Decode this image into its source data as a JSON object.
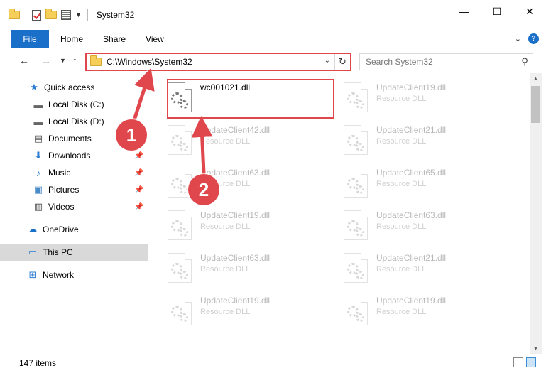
{
  "window": {
    "title": "System32",
    "controls": {
      "minimize": "—",
      "maximize": "☐",
      "close": "✕"
    }
  },
  "ribbon": {
    "tabs": [
      {
        "label": "File"
      },
      {
        "label": "Home"
      },
      {
        "label": "Share"
      },
      {
        "label": "View"
      }
    ]
  },
  "address": {
    "path": "C:\\Windows\\System32",
    "search_placeholder": "Search System32"
  },
  "sidebar": {
    "items": [
      {
        "label": "Quick access",
        "icon": "star-icon"
      },
      {
        "label": "Local Disk (C:)",
        "icon": "drive-icon"
      },
      {
        "label": "Local Disk (D:)",
        "icon": "drive-icon"
      },
      {
        "label": "Documents",
        "icon": "document-icon"
      },
      {
        "label": "Downloads",
        "icon": "download-icon"
      },
      {
        "label": "Music",
        "icon": "music-icon"
      },
      {
        "label": "Pictures",
        "icon": "pictures-icon"
      },
      {
        "label": "Videos",
        "icon": "videos-icon"
      },
      {
        "label": "OneDrive",
        "icon": "cloud-icon"
      },
      {
        "label": "This PC",
        "icon": "computer-icon"
      },
      {
        "label": "Network",
        "icon": "network-icon"
      }
    ]
  },
  "files": [
    {
      "name": "wc001021.dll",
      "type": ""
    },
    {
      "name": "UpdateClient19.dll",
      "type": "Resource DLL"
    },
    {
      "name": "UpdateClient42.dll",
      "type": "Resource DLL"
    },
    {
      "name": "UpdateClient21.dll",
      "type": "Resource DLL"
    },
    {
      "name": "UpdateClient63.dll",
      "type": "Resource DLL"
    },
    {
      "name": "UpdateClient65.dll",
      "type": "Resource DLL"
    },
    {
      "name": "UpdateClient19.dll",
      "type": "Resource DLL"
    },
    {
      "name": "UpdateClient63.dll",
      "type": "Resource DLL"
    },
    {
      "name": "UpdateClient63.dll",
      "type": "Resource DLL"
    },
    {
      "name": "UpdateClient21.dll",
      "type": "Resource DLL"
    },
    {
      "name": "UpdateClient19.dll",
      "type": "Resource DLL"
    },
    {
      "name": "UpdateClient19.dll",
      "type": "Resource DLL"
    }
  ],
  "status": {
    "item_count": "147 items"
  },
  "annotations": {
    "step1": "1",
    "step2": "2"
  },
  "colors": {
    "accent": "#1a6fc9",
    "annotation": "#e0474c"
  }
}
